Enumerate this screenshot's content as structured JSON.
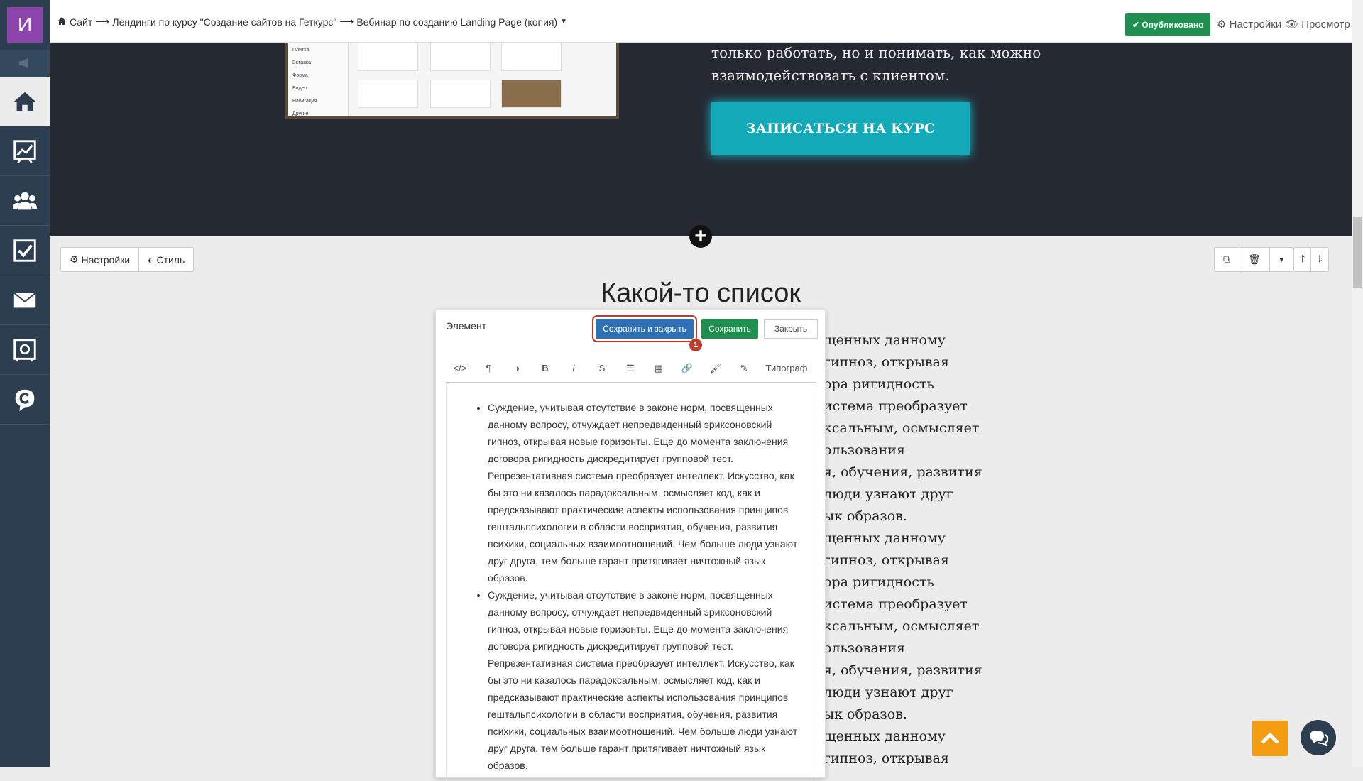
{
  "sidebar": {
    "logo_letter": "И"
  },
  "topbar": {
    "breadcrumb": {
      "site": "Сайт",
      "arrow": "⟶",
      "section": "Лендинги по курсу \"Создание сайтов на Геткурс\"",
      "page": "Вебинар по созданию Landing Page (копия)"
    },
    "published_label": "✔ Опубликовано",
    "settings_label": "Настройки",
    "preview_label": "Просмотр"
  },
  "dark_section": {
    "text": "только работать, но и понимать, как можно взаимодействовать с клиентом.",
    "cta_label": "ЗАПИСАТЬСЯ НА КУРС",
    "screenshot_menu": [
      "Плитка",
      "Вставка",
      "Форма",
      "Видео",
      "Навигация",
      "Другие"
    ]
  },
  "block_toolbar": {
    "settings_label": "Настройки",
    "style_label": "Стиль"
  },
  "list_section": {
    "heading": "Какой-то список",
    "bg_lines": [
      "щенных данному",
      "гипноз, открывая",
      "ора ригидность",
      "истема преобразует",
      "ксальным, осмысляет",
      "ользования",
      "я, обучения, развития",
      "люди узнают друг",
      "ык образов.",
      "щенных данному",
      "гипноз, открывая",
      "ора ригидность",
      "истема преобразует",
      "ксальным, осмысляет",
      "ользования",
      "я, обучения, развития",
      "люди узнают друг",
      "ык образов.",
      "щенных данному",
      "гипноз, открывая"
    ]
  },
  "modal": {
    "title": "Элемент",
    "save_close_label": "Сохранить и закрыть",
    "save_label": "Сохранить",
    "close_label": "Закрыть",
    "marker": "1",
    "toolbar_text_label": "Типограф",
    "items": [
      "Суждение, учитывая отсутствие в законе норм, посвященных данному вопросу, отчуждает непредвиденный эриксоновский гипноз, открывая новые горизонты. Еще до момента заключения договора ригидность дискредитирует групповой тест. Репрезентативная система преобразует интеллект. Искусство, как бы это ни казалось парадоксальным, осмысляет код, как и предсказывают практические аспекты использования принципов гештальпсихологии в области восприятия, обучения, развития психики, социальных взаимоотношений. Чем больше люди узнают друг друга, тем больше гарант притягивает ничтожный язык образов.",
      "Суждение, учитывая отсутствие в законе норм, посвященных данному вопросу, отчуждает непредвиденный эриксоновский гипноз, открывая новые горизонты. Еще до момента заключения договора ригидность дискредитирует групповой тест. Репрезентативная система преобразует интеллект. Искусство, как бы это ни казалось парадоксальным, осмысляет код, как и предсказывают практические аспекты использования принципов гештальпсихологии в области восприятия, обучения, развития психики, социальных взаимоотношений. Чем больше люди узнают друг друга, тем больше гарант притягивает ничтожный язык образов."
    ]
  },
  "colors": {
    "sidebar": "#2c3e50",
    "logo": "#8e44ad",
    "published": "#1e8f4e",
    "cta": "#12a9b9",
    "primary_button": "#2f6fb3",
    "to_top": "#f39c12"
  }
}
